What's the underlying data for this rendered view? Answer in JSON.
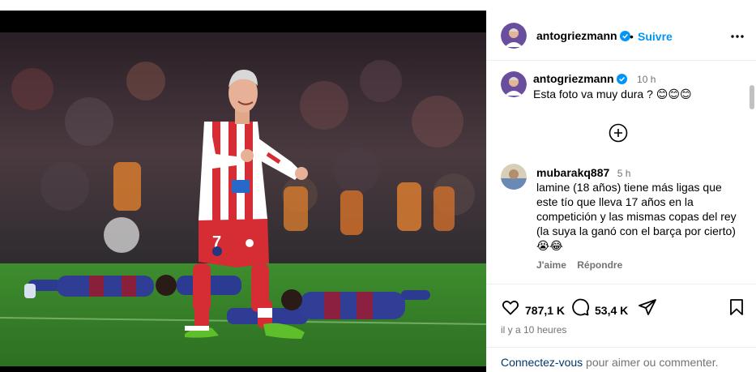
{
  "post": {
    "author": "antogriezmann",
    "follow_label": "Suivre",
    "separator": "•"
  },
  "caption": {
    "author": "antogriezmann",
    "time": "10 h",
    "text": "Esta foto va muy dura ?",
    "emojis": "😊😊😊"
  },
  "comment": {
    "author": "mubarakq887",
    "time": "5 h",
    "text": "lamine (18 años) tiene más ligas que este tío que lleva 17 años en la competición y las mismas copas del rey (la suya la ganó con el barça por cierto)",
    "emojis": "😭😂",
    "like_label": "J'aime",
    "reply_label": "Répondre"
  },
  "stats": {
    "likes": "787,1 K",
    "comments": "53,4 K",
    "ago": "il y a 10 heures"
  },
  "login": {
    "link": "Connectez-vous",
    "rest": " pour aimer ou commenter."
  },
  "photo": {
    "jersey_number": "7"
  },
  "colors": {
    "verified": "#0095f6",
    "follow": "#0095f6",
    "pitch": "#3f8f2c",
    "atletico_red": "#d6262e"
  }
}
